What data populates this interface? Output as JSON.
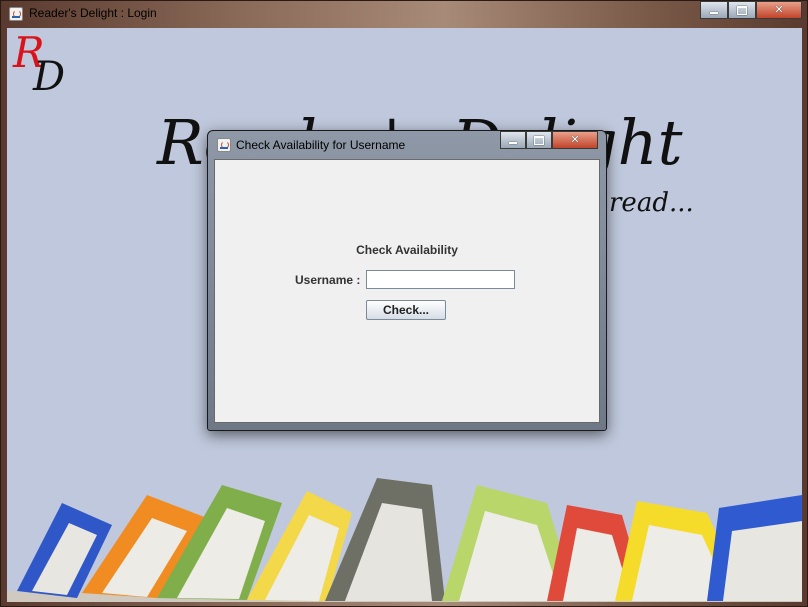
{
  "main_window": {
    "title": "Reader's Delight : Login",
    "logo_letters": [
      "R",
      "D"
    ],
    "brand_title": "Reader's Delight",
    "tagline": "read..."
  },
  "dialog": {
    "title": "Check Availability for Username",
    "heading": "Check Availability",
    "username_label": "Username :",
    "username_value": "",
    "check_button": "Check..."
  },
  "colors": {
    "content_background": "#bfc8dc",
    "dialog_background": "#f0f0f0",
    "logo_r": "#d8141a",
    "close_button": "#c0442a"
  },
  "icons": [
    "java-icon",
    "minimize-icon",
    "maximize-icon",
    "close-icon"
  ]
}
